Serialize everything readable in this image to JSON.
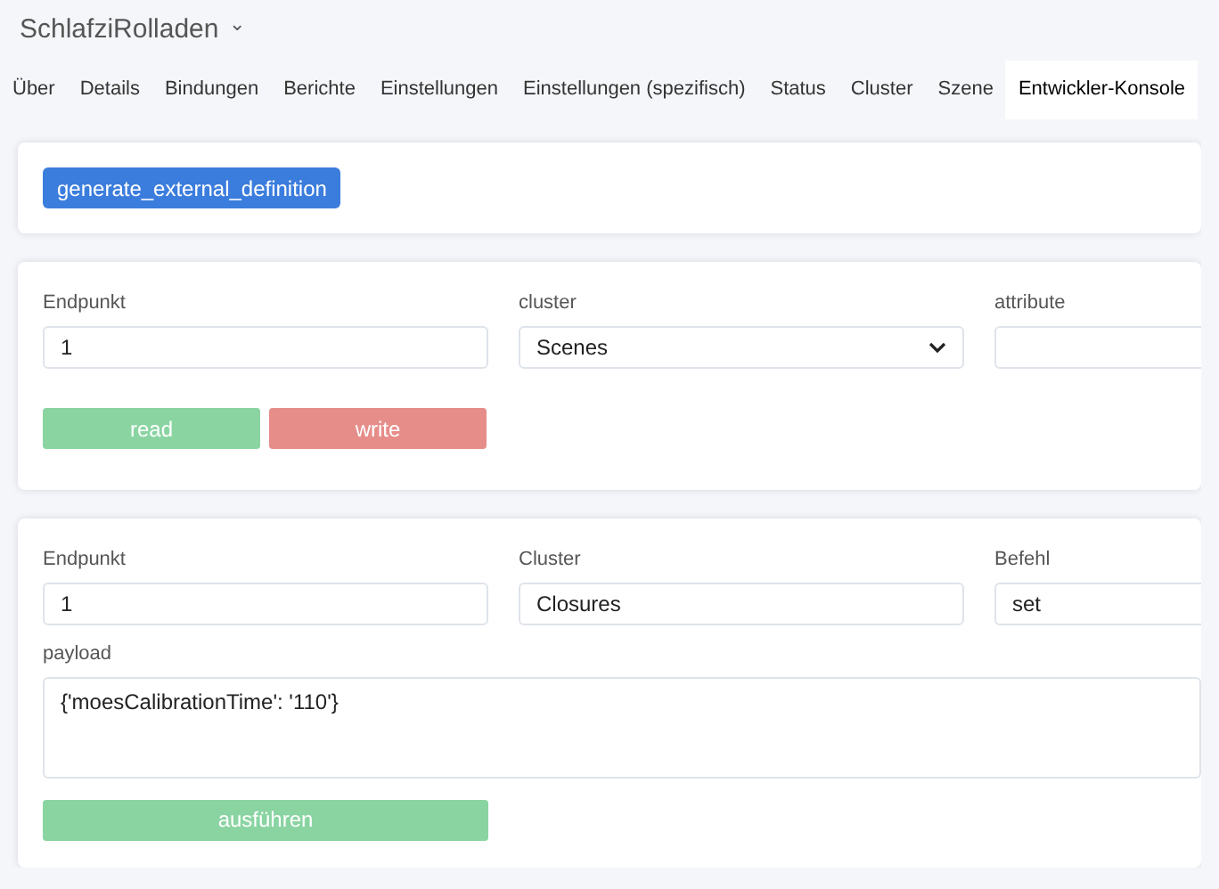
{
  "device": {
    "title": "SchlafziRolladen",
    "caret": "⌄"
  },
  "tabs": [
    {
      "label": "Über",
      "selected": false
    },
    {
      "label": "Details",
      "selected": false
    },
    {
      "label": "Bindungen",
      "selected": false
    },
    {
      "label": "Berichte",
      "selected": false
    },
    {
      "label": "Einstellungen",
      "selected": false
    },
    {
      "label": "Einstellungen (spezifisch)",
      "selected": false
    },
    {
      "label": "Status",
      "selected": false
    },
    {
      "label": "Cluster",
      "selected": false
    },
    {
      "label": "Szene",
      "selected": false
    },
    {
      "label": "Entwickler-Konsole",
      "selected": true
    }
  ],
  "definition_card": {
    "button": "generate_external_definition"
  },
  "attribute_card": {
    "fields": [
      {
        "kind": "input",
        "label": "Endpunkt",
        "value": "1"
      },
      {
        "kind": "select",
        "label": "cluster",
        "value": "Scenes"
      },
      {
        "kind": "input",
        "label": "attribute"
      }
    ],
    "buttons": [
      {
        "label": "read",
        "kind": "success"
      },
      {
        "label": "write",
        "kind": "danger"
      }
    ]
  },
  "command_card": {
    "fields": [
      {
        "kind": "input",
        "label": "Endpunkt",
        "value": "1"
      },
      {
        "kind": "input",
        "label": "Cluster",
        "value": "Closures"
      },
      {
        "kind": "input",
        "label": "Befehl",
        "value": "set"
      }
    ],
    "payload": {
      "label": "payload",
      "value": "{'moesCalibrationTime': '110'}"
    },
    "button": {
      "label": "ausführen",
      "kind": "success"
    }
  }
}
